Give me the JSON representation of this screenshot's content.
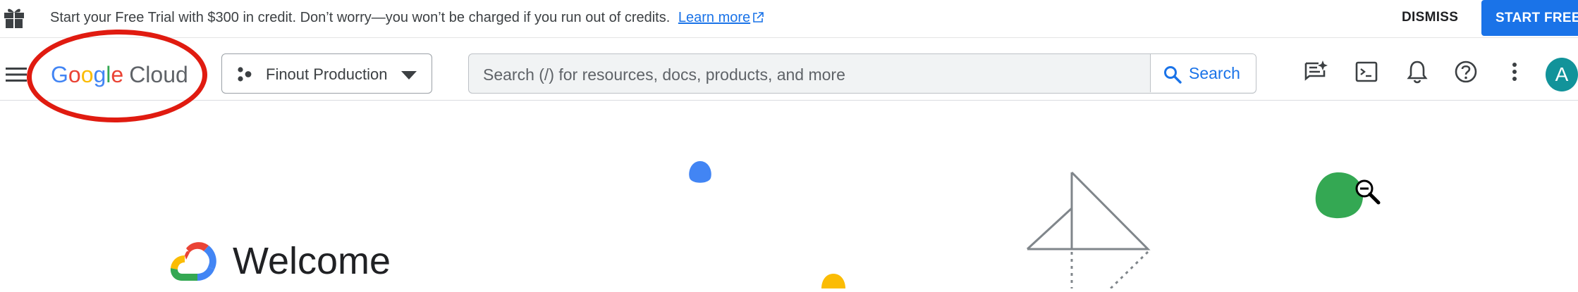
{
  "banner": {
    "message": "Start your Free Trial with $300 in credit. Don’t worry—you won’t be charged if you run out of credits.",
    "learn_more": "Learn more",
    "dismiss": "DISMISS",
    "start_free": "START FREE"
  },
  "nav": {
    "logo_letters": [
      "G",
      "o",
      "o",
      "g",
      "l",
      "e"
    ],
    "logo_product": "Cloud",
    "project": "Finout Production",
    "search_placeholder": "Search (/) for resources, docs, products, and more",
    "search_button": "Search",
    "avatar_initial": "A",
    "icons": [
      "menu-icon",
      "project-icon",
      "dropdown-icon",
      "search-icon",
      "gemini-chat-icon",
      "cloud-shell-icon",
      "notifications-icon",
      "help-icon",
      "more-vert-icon"
    ]
  },
  "main": {
    "welcome": "Welcome"
  },
  "colors": {
    "accent": "#1a73e8",
    "annotation": "#e01b10",
    "avatar": "#12939a"
  }
}
